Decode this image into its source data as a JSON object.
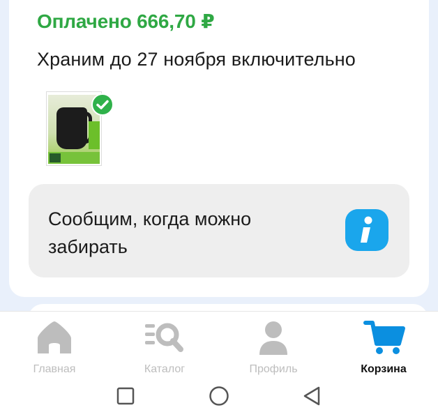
{
  "order": {
    "paid_text": "Оплачено 666,70 ₽",
    "storage_text": "Храним до 27 ноября включительно"
  },
  "notify": {
    "text": "Сообщим, когда можно забирать"
  },
  "tabbar": {
    "items": [
      {
        "label": "Главная",
        "icon": "home-icon",
        "active": false
      },
      {
        "label": "Каталог",
        "icon": "catalog-search-icon",
        "active": false
      },
      {
        "label": "Профиль",
        "icon": "profile-icon",
        "active": false
      },
      {
        "label": "Корзина",
        "icon": "cart-icon",
        "active": true
      }
    ]
  },
  "colors": {
    "paid_green": "#2fa844",
    "accent_blue": "#1aa6ec",
    "cart_blue": "#0b8fe0",
    "inactive_gray": "#bdbdbd"
  },
  "system_nav": {
    "buttons": [
      "recents-square-icon",
      "home-circle-icon",
      "back-triangle-icon"
    ]
  }
}
